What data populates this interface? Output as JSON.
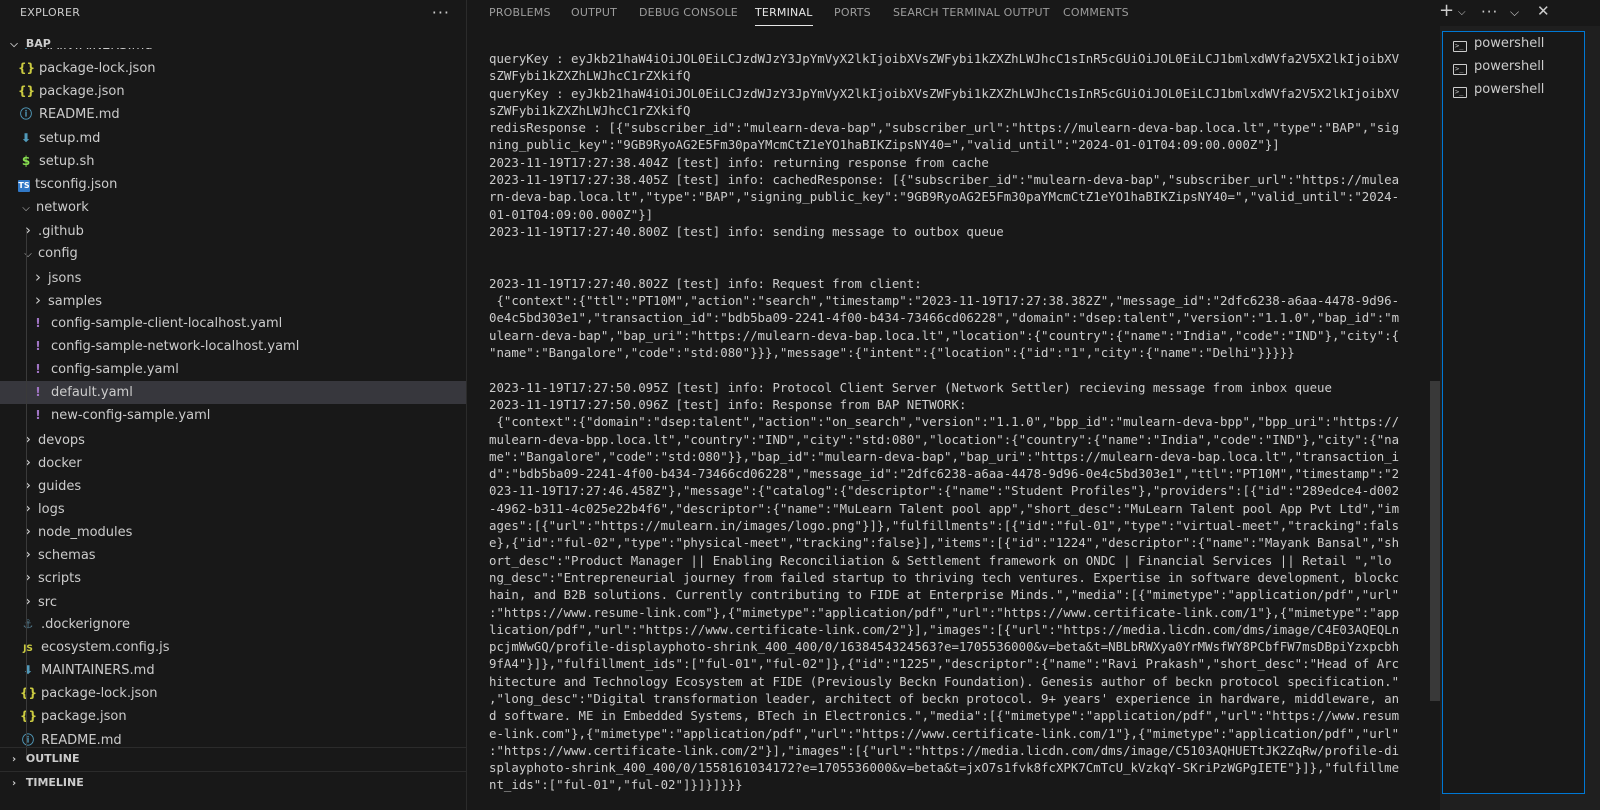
{
  "explorer": {
    "title": "EXPLORER",
    "more_icon": "ellipsis-icon",
    "root_label": "BAP",
    "outline_label": "OUTLINE",
    "timeline_label": "TIMELINE",
    "items": [
      {
        "label": "MAINTAINERS.md",
        "icon": "markdown-icon",
        "depth": 1,
        "type": "file"
      },
      {
        "label": "package-lock.json",
        "icon": "json-icon",
        "depth": 1,
        "type": "file"
      },
      {
        "label": "package.json",
        "icon": "json-icon",
        "depth": 1,
        "type": "file"
      },
      {
        "label": "README.md",
        "icon": "info-icon",
        "depth": 1,
        "type": "file"
      },
      {
        "label": "setup.md",
        "icon": "markdown-icon",
        "depth": 1,
        "type": "file"
      },
      {
        "label": "setup.sh",
        "icon": "shell-icon",
        "depth": 1,
        "type": "file"
      },
      {
        "label": "tsconfig.json",
        "icon": "typescript-icon",
        "depth": 1,
        "type": "file"
      },
      {
        "label": "network",
        "icon": "chevron-down-icon",
        "depth": 1,
        "type": "folder-open"
      },
      {
        "label": ".github",
        "icon": "chevron-right-icon",
        "depth": 2,
        "type": "folder"
      },
      {
        "label": "config",
        "icon": "chevron-down-icon",
        "depth": 2,
        "type": "folder-open"
      },
      {
        "label": "jsons",
        "icon": "chevron-right-icon",
        "depth": 3,
        "type": "folder"
      },
      {
        "label": "samples",
        "icon": "chevron-right-icon",
        "depth": 3,
        "type": "folder"
      },
      {
        "label": "config-sample-client-localhost.yaml",
        "icon": "yaml-icon",
        "depth": 3,
        "type": "file"
      },
      {
        "label": "config-sample-network-localhost.yaml",
        "icon": "yaml-icon",
        "depth": 3,
        "type": "file"
      },
      {
        "label": "config-sample.yaml",
        "icon": "yaml-icon",
        "depth": 3,
        "type": "file"
      },
      {
        "label": "default.yaml",
        "icon": "yaml-icon",
        "depth": 3,
        "type": "file",
        "selected": true
      },
      {
        "label": "new-config-sample.yaml",
        "icon": "yaml-icon",
        "depth": 3,
        "type": "file"
      },
      {
        "label": "devops",
        "icon": "chevron-right-icon",
        "depth": 2,
        "type": "folder"
      },
      {
        "label": "docker",
        "icon": "chevron-right-icon",
        "depth": 2,
        "type": "folder"
      },
      {
        "label": "guides",
        "icon": "chevron-right-icon",
        "depth": 2,
        "type": "folder"
      },
      {
        "label": "logs",
        "icon": "chevron-right-icon",
        "depth": 2,
        "type": "folder"
      },
      {
        "label": "node_modules",
        "icon": "chevron-right-icon",
        "depth": 2,
        "type": "folder"
      },
      {
        "label": "schemas",
        "icon": "chevron-right-icon",
        "depth": 2,
        "type": "folder"
      },
      {
        "label": "scripts",
        "icon": "chevron-right-icon",
        "depth": 2,
        "type": "folder"
      },
      {
        "label": "src",
        "icon": "chevron-right-icon",
        "depth": 2,
        "type": "folder"
      },
      {
        "label": ".dockerignore",
        "icon": "docker-icon",
        "depth": 2,
        "type": "file"
      },
      {
        "label": "ecosystem.config.js",
        "icon": "javascript-icon",
        "depth": 2,
        "type": "file"
      },
      {
        "label": "MAINTAINERS.md",
        "icon": "markdown-icon",
        "depth": 2,
        "type": "file"
      },
      {
        "label": "package-lock.json",
        "icon": "json-icon",
        "depth": 2,
        "type": "file"
      },
      {
        "label": "package.json",
        "icon": "json-icon",
        "depth": 2,
        "type": "file"
      },
      {
        "label": "README.md",
        "icon": "info-icon",
        "depth": 2,
        "type": "file"
      }
    ]
  },
  "panel": {
    "tabs": [
      "PROBLEMS",
      "OUTPUT",
      "DEBUG CONSOLE",
      "TERMINAL",
      "PORTS",
      "SEARCH TERMINAL OUTPUT",
      "COMMENTS"
    ],
    "active_tab": "TERMINAL",
    "actions": [
      "plus-icon",
      "chevron-down-icon",
      "ellipsis-icon",
      "chevron-down-icon",
      "close-icon"
    ]
  },
  "terminal": {
    "lines": [
      "queryKey : eyJkb21haW4iOiJOL0EiLCJzdWJzY3JpYmVyX2lkIjoibXVsZWFybi1kZXZhLWJhcC1sInR5cGUiOiJOL0EiLCJ1bmlxdWVfa2V5X2lkIjoibXV",
      "sZWFybi1kZXZhLWJhcC1rZXkifQ",
      "queryKey : eyJkb21haW4iOiJOL0EiLCJzdWJzY3JpYmVyX2lkIjoibXVsZWFybi1kZXZhLWJhcC1sInR5cGUiOiJOL0EiLCJ1bmlxdWVfa2V5X2lkIjoibXV",
      "sZWFybi1kZXZhLWJhcC1rZXkifQ",
      "redisResponse : [{\"subscriber_id\":\"mulearn-deva-bap\",\"subscriber_url\":\"https://mulearn-deva-bap.loca.lt\",\"type\":\"BAP\",\"sig",
      "ning_public_key\":\"9GB9RyoAG2E5Fm30paYMcmCtZ1eYO1haBIKZipsNY40=\",\"valid_until\":\"2024-01-01T04:09:00.000Z\"}]",
      "2023-11-19T17:27:38.404Z [test] info: returning response from cache",
      "2023-11-19T17:27:38.405Z [test] info: cachedResponse: [{\"subscriber_id\":\"mulearn-deva-bap\",\"subscriber_url\":\"https://mulea",
      "rn-deva-bap.loca.lt\",\"type\":\"BAP\",\"signing_public_key\":\"9GB9RyoAG2E5Fm30paYMcmCtZ1eYO1haBIKZipsNY40=\",\"valid_until\":\"2024-",
      "01-01T04:09:00.000Z\"}]",
      "2023-11-19T17:27:40.800Z [test] info: sending message to outbox queue",
      "",
      "",
      "2023-11-19T17:27:40.802Z [test] info: Request from client:",
      " {\"context\":{\"ttl\":\"PT10M\",\"action\":\"search\",\"timestamp\":\"2023-11-19T17:27:38.382Z\",\"message_id\":\"2dfc6238-a6aa-4478-9d96-",
      "0e4c5bd303e1\",\"transaction_id\":\"bdb5ba09-2241-4f00-b434-73466cd06228\",\"domain\":\"dsep:talent\",\"version\":\"1.1.0\",\"bap_id\":\"m",
      "ulearn-deva-bap\",\"bap_uri\":\"https://mulearn-deva-bap.loca.lt\",\"location\":{\"country\":{\"name\":\"India\",\"code\":\"IND\"},\"city\":{",
      "\"name\":\"Bangalore\",\"code\":\"std:080\"}}},\"message\":{\"intent\":{\"location\":{\"id\":\"1\",\"city\":{\"name\":\"Delhi\"}}}}}",
      "",
      "2023-11-19T17:27:50.095Z [test] info: Protocol Client Server (Network Settler) recieving message from inbox queue",
      "2023-11-19T17:27:50.096Z [test] info: Response from BAP NETWORK:",
      " {\"context\":{\"domain\":\"dsep:talent\",\"action\":\"on_search\",\"version\":\"1.1.0\",\"bpp_id\":\"mulearn-deva-bpp\",\"bpp_uri\":\"https://",
      "mulearn-deva-bpp.loca.lt\",\"country\":\"IND\",\"city\":\"std:080\",\"location\":{\"country\":{\"name\":\"India\",\"code\":\"IND\"},\"city\":{\"na",
      "me\":\"Bangalore\",\"code\":\"std:080\"}},\"bap_id\":\"mulearn-deva-bap\",\"bap_uri\":\"https://mulearn-deva-bap.loca.lt\",\"transaction_i",
      "d\":\"bdb5ba09-2241-4f00-b434-73466cd06228\",\"message_id\":\"2dfc6238-a6aa-4478-9d96-0e4c5bd303e1\",\"ttl\":\"PT10M\",\"timestamp\":\"2",
      "023-11-19T17:27:46.458Z\"},\"message\":{\"catalog\":{\"descriptor\":{\"name\":\"Student Profiles\"},\"providers\":[{\"id\":\"289edce4-d002",
      "-4962-b311-4c025e22b4f6\",\"descriptor\":{\"name\":\"MuLearn Talent pool app\",\"short_desc\":\"MuLearn Talent pool App Pvt Ltd\",\"im",
      "ages\":[{\"url\":\"https://mulearn.in/images/logo.png\"}]},\"fulfillments\":[{\"id\":\"ful-01\",\"type\":\"virtual-meet\",\"tracking\":fals",
      "e},{\"id\":\"ful-02\",\"type\":\"physical-meet\",\"tracking\":false}],\"items\":[{\"id\":\"1224\",\"descriptor\":{\"name\":\"Mayank Bansal\",\"sh",
      "ort_desc\":\"Product Manager || Enabling Reconciliation & Settlement framework on ONDC | Financial Services || Retail \",\"lo",
      "ng_desc\":\"Entrepreneurial journey from failed startup to thriving tech ventures. Expertise in software development, blockc",
      "hain, and B2B solutions. Currently contributing to FIDE at Enterprise Minds.\",\"media\":[{\"mimetype\":\"application/pdf\",\"url\"",
      ":\"https://www.resume-link.com\"},{\"mimetype\":\"application/pdf\",\"url\":\"https://www.certificate-link.com/1\"},{\"mimetype\":\"app",
      "lication/pdf\",\"url\":\"https://www.certificate-link.com/2\"}],\"images\":[{\"url\":\"https://media.licdn.com/dms/image/C4E03AQEQLn",
      "pcjmWwGQ/profile-displayphoto-shrink_400_400/0/1638454324563?e=1705536000&v=beta&t=NBLbRWXya0YrMWsfWY8PCbfFW7msDBpiYzxpcbh",
      "9fA4\"}]},\"fulfillment_ids\":[\"ful-01\",\"ful-02\"]},{\"id\":\"1225\",\"descriptor\":{\"name\":\"Ravi Prakash\",\"short_desc\":\"Head of Arc",
      "hitecture and Technology Ecosystem at FIDE (Previously Beckn Foundation). Genesis author of beckn protocol specification.\"",
      ",\"long_desc\":\"Digital transformation leader, architect of beckn protocol. 9+ years' experience in hardware, middleware, an",
      "d software. ME in Embedded Systems, BTech in Electronics.\",\"media\":[{\"mimetype\":\"application/pdf\",\"url\":\"https://www.resum",
      "e-link.com\"},{\"mimetype\":\"application/pdf\",\"url\":\"https://www.certificate-link.com/1\"},{\"mimetype\":\"application/pdf\",\"url\"",
      ":\"https://www.certificate-link.com/2\"}],\"images\":[{\"url\":\"https://media.licdn.com/dms/image/C5103AQHUETtJK2ZqRw/profile-di",
      "splayphoto-shrink_400_400/0/1558161034172?e=1705536000&v=beta&t=jxO7s1fvk8fcXPK7CmTcU_kVzkqY-SKriPzWGPgIETE\"}]},\"fulfillme",
      "nt_ids\":[\"ful-01\",\"ful-02\"]}]}]}}}"
    ]
  },
  "terminal_list": {
    "items": [
      {
        "label": "powershell",
        "icon": "terminal-icon"
      },
      {
        "label": "powershell",
        "icon": "terminal-icon"
      },
      {
        "label": "powershell",
        "icon": "terminal-icon"
      }
    ]
  },
  "colors": {
    "background": "#181818",
    "selection": "#37373d",
    "focus_border": "#0078d4",
    "text": "#cccccc"
  }
}
